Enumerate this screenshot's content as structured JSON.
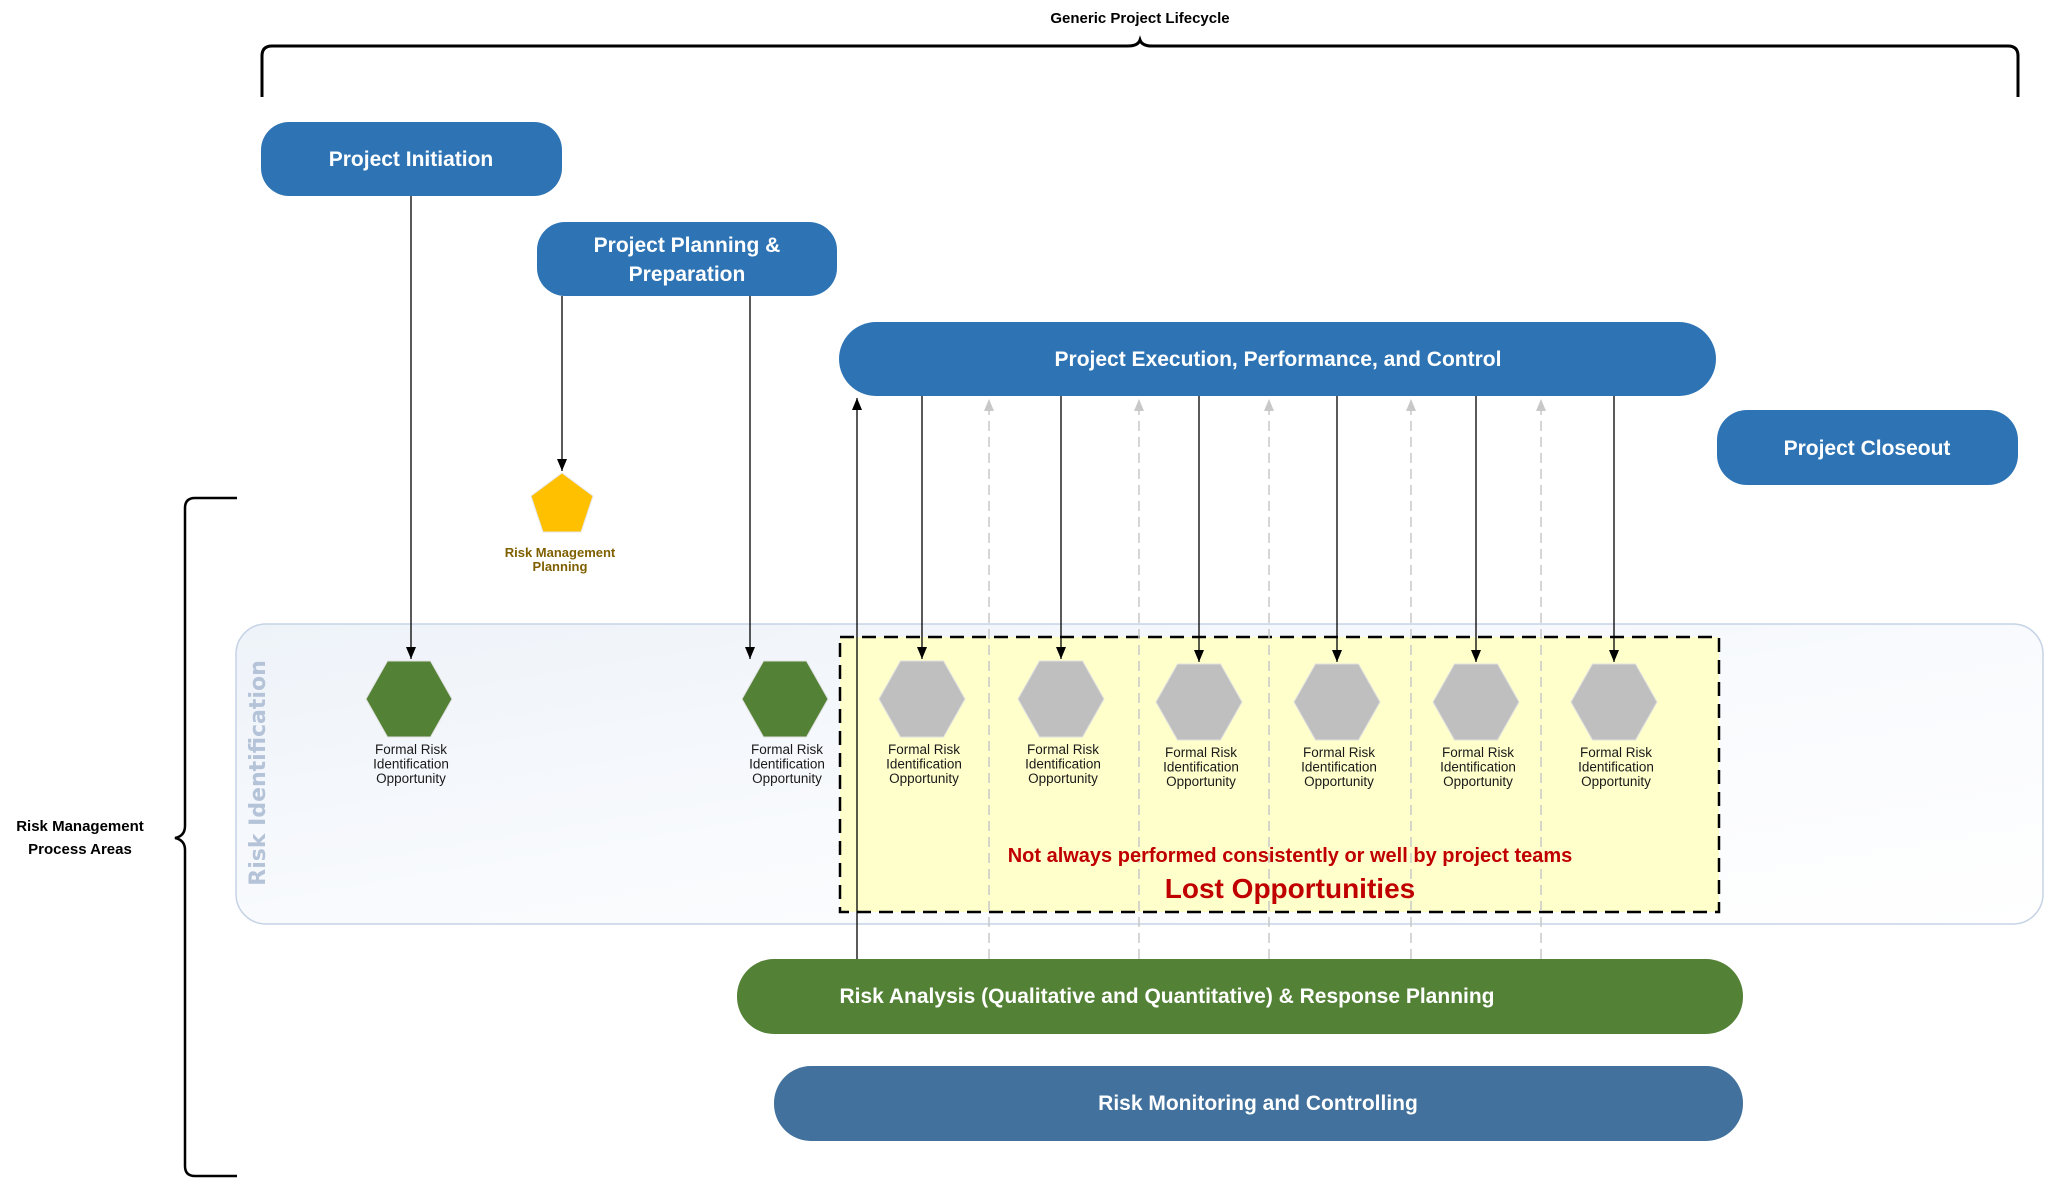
{
  "title": "Generic Project Lifecycle",
  "side_bracket": {
    "line1": "Risk Management",
    "line2": "Process Areas"
  },
  "phases": {
    "initiation": "Project Initiation",
    "planning_line1": "Project Planning &",
    "planning_line2": "Preparation",
    "execution": "Project Execution, Performance, and Control",
    "closeout": "Project Closeout"
  },
  "risk_management_planning": {
    "line1": "Risk Management",
    "line2": "Planning",
    "color": "#FFC000"
  },
  "risk_identification_lane": {
    "label": "Risk Identification"
  },
  "opportunity_label": {
    "line1": "Formal Risk",
    "line2": "Identification",
    "line3": "Opportunity"
  },
  "formal_opportunities": [
    {
      "status": "performed",
      "color": "#538135"
    },
    {
      "status": "performed",
      "color": "#538135"
    },
    {
      "status": "lost",
      "color": "#BFBFBF"
    },
    {
      "status": "lost",
      "color": "#BFBFBF"
    },
    {
      "status": "lost",
      "color": "#BFBFBF"
    },
    {
      "status": "lost",
      "color": "#BFBFBF"
    },
    {
      "status": "lost",
      "color": "#BFBFBF"
    },
    {
      "status": "lost",
      "color": "#BFBFBF"
    }
  ],
  "lost_opportunities_box": {
    "note": "Not always performed consistently or well by project teams",
    "heading": "Lost Opportunities"
  },
  "process_bands": {
    "analysis": "Risk Analysis (Qualitative and Quantitative) & Response Planning",
    "monitoring": "Risk Monitoring and Controlling"
  },
  "colors": {
    "phase_blue": "#2E74B5",
    "analysis_green": "#538135",
    "monitoring_blue": "#41719C",
    "lost_fill": "#FFFFCC",
    "warning_red": "#C00000"
  }
}
